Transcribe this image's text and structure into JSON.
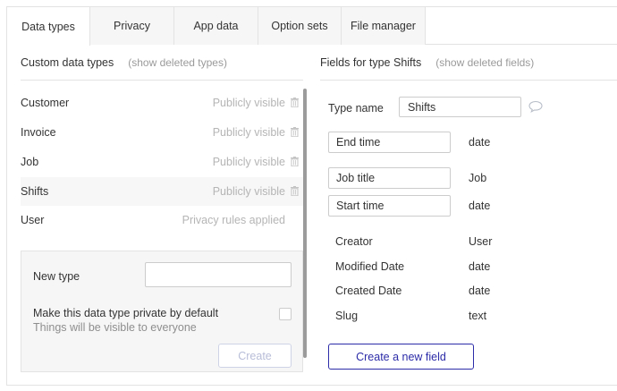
{
  "tabs": [
    {
      "label": "Data types",
      "active": true
    },
    {
      "label": "Privacy"
    },
    {
      "label": "App data"
    },
    {
      "label": "Option sets"
    },
    {
      "label": "File manager"
    }
  ],
  "left": {
    "title": "Custom data types",
    "show_deleted": "(show deleted types)",
    "types": [
      {
        "name": "Customer",
        "visibility": "Publicly visible",
        "trash": true
      },
      {
        "name": "Invoice",
        "visibility": "Publicly visible",
        "trash": true
      },
      {
        "name": "Job",
        "visibility": "Publicly visible",
        "trash": true
      },
      {
        "name": "Shifts",
        "visibility": "Publicly visible",
        "trash": true,
        "selected": true
      },
      {
        "name": "User",
        "visibility": "Privacy rules applied",
        "trash": false
      }
    ],
    "new_type": {
      "label": "New type",
      "input_value": "",
      "private_label": "Make this data type private by default",
      "private_sub": "Things will be visible to everyone",
      "private_checked": false,
      "create_label": "Create"
    }
  },
  "right": {
    "title": "Fields for type Shifts",
    "show_deleted": "(show deleted fields)",
    "type_name_label": "Type name",
    "type_name_value": "Shifts",
    "fields": [
      {
        "name": "End time",
        "type": "date"
      },
      {
        "name": "Job title",
        "type": "Job"
      },
      {
        "name": "Start time",
        "type": "date"
      }
    ],
    "builtin_fields": [
      {
        "name": "Creator",
        "type": "User"
      },
      {
        "name": "Modified Date",
        "type": "date"
      },
      {
        "name": "Created Date",
        "type": "date"
      },
      {
        "name": "Slug",
        "type": "text"
      }
    ],
    "new_field_label": "Create a new field"
  },
  "colors": {
    "accent": "#2c2ba8",
    "muted_text": "#b5b5b5",
    "border": "#e3e3e3",
    "tab_bg": "#f6f6f6"
  },
  "icons": {
    "trash": "trash-icon",
    "comment": "comment-icon"
  }
}
